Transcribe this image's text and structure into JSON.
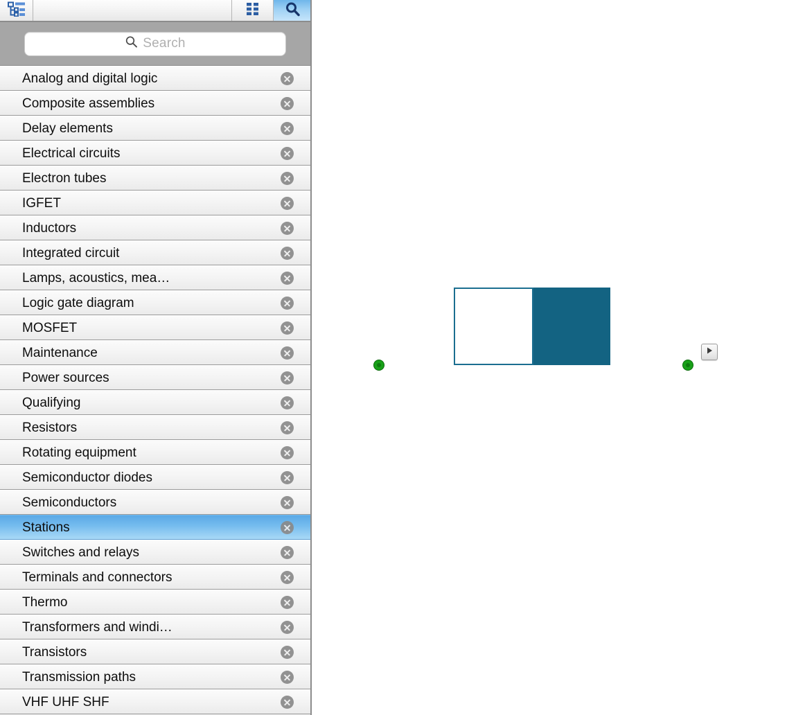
{
  "panel": {
    "toolbar": {
      "tree_icon": "tree-outline-icon",
      "grid_icon": "grid-view-icon",
      "search_icon": "magnifier-icon",
      "active_button": "search"
    },
    "search": {
      "placeholder": "Search",
      "value": "",
      "icon": "magnifier-icon"
    },
    "remove_icon": "circle-x-icon",
    "selected_item": "Stations",
    "items": [
      {
        "label": "Analog and digital logic",
        "selected": false
      },
      {
        "label": "Composite assemblies",
        "selected": false
      },
      {
        "label": "Delay elements",
        "selected": false
      },
      {
        "label": "Electrical circuits",
        "selected": false
      },
      {
        "label": "Electron tubes",
        "selected": false
      },
      {
        "label": "IGFET",
        "selected": false
      },
      {
        "label": "Inductors",
        "selected": false
      },
      {
        "label": "Integrated circuit",
        "selected": false
      },
      {
        "label": "Lamps, acoustics, mea…",
        "selected": false
      },
      {
        "label": "Logic gate diagram",
        "selected": false
      },
      {
        "label": "MOSFET",
        "selected": false
      },
      {
        "label": "Maintenance",
        "selected": false
      },
      {
        "label": "Power sources",
        "selected": false
      },
      {
        "label": "Qualifying",
        "selected": false
      },
      {
        "label": "Resistors",
        "selected": false
      },
      {
        "label": "Rotating equipment",
        "selected": false
      },
      {
        "label": "Semiconductor diodes",
        "selected": false
      },
      {
        "label": "Semiconductors",
        "selected": false
      },
      {
        "label": "Stations",
        "selected": true
      },
      {
        "label": "Switches and relays",
        "selected": false
      },
      {
        "label": "Terminals and connectors",
        "selected": false
      },
      {
        "label": "Thermo",
        "selected": false
      },
      {
        "label": "Transformers and windi…",
        "selected": false
      },
      {
        "label": "Transistors",
        "selected": false
      },
      {
        "label": "Transmission paths",
        "selected": false
      },
      {
        "label": "VHF UHF SHF",
        "selected": false
      }
    ]
  },
  "canvas": {
    "background": "#ffffff",
    "shape": {
      "name": "two-tone-rectangle",
      "fill_left": "#ffffff",
      "fill_right": "#136382",
      "stroke": "#1b6e90"
    },
    "connection_points": [
      {
        "name": "connection-point-left",
        "color": "#18a018"
      },
      {
        "name": "connection-point-right",
        "color": "#18a018"
      }
    ],
    "badge": {
      "name": "play-arrow-badge",
      "icon": "play-triangle-icon"
    }
  }
}
